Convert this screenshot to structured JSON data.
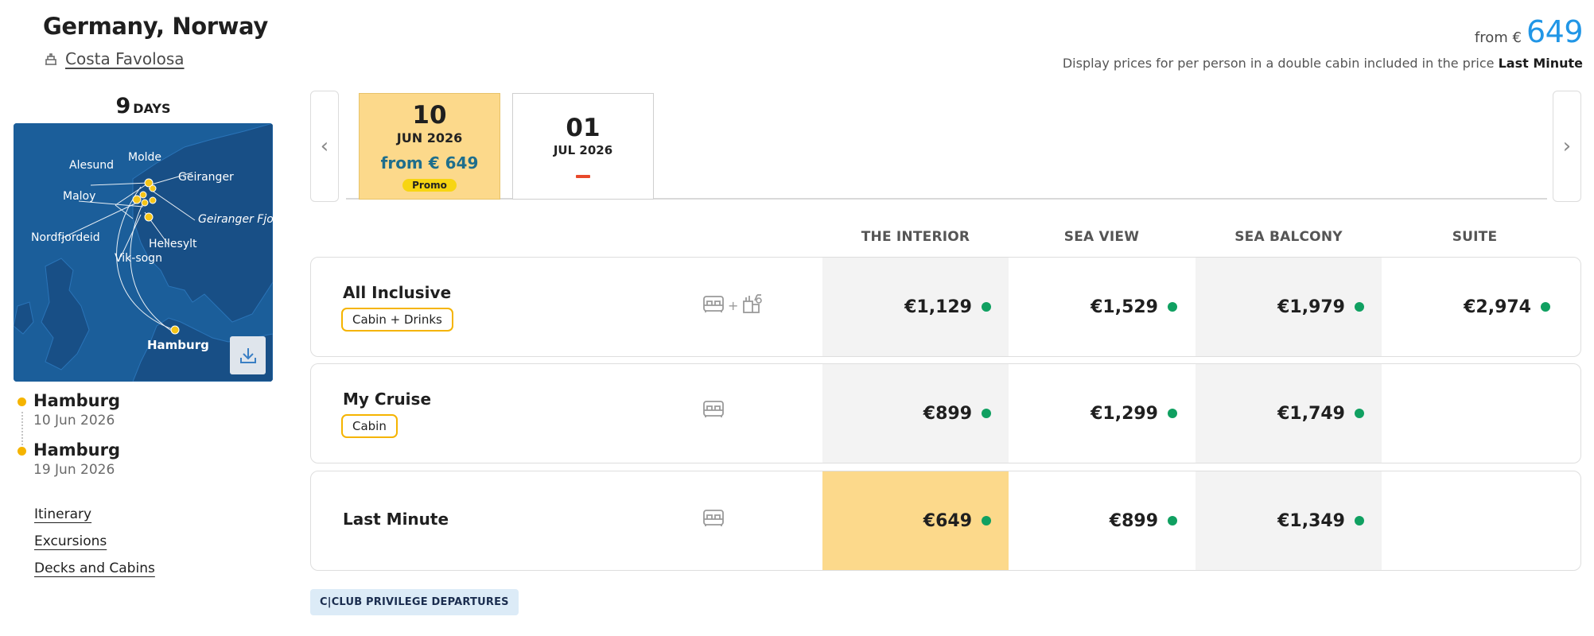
{
  "header": {
    "title": "Germany, Norway",
    "ship_name": "Costa Favolosa",
    "from_label": "from €",
    "from_amount": "649",
    "note_prefix": "Display prices for per person in a double cabin included in the price",
    "note_bold": "Last Minute"
  },
  "trip": {
    "days_number": "9",
    "days_unit": "DAYS"
  },
  "map": {
    "labels": {
      "molde": "Molde",
      "alesund": "Alesund",
      "geiranger": "Geiranger",
      "maloy": "Maloy",
      "geiranger_fjord": "Geiranger Fjord",
      "nordfjordeid": "Nordfjordeid",
      "hellesylt": "Hellesylt",
      "vik_sogn": "Vik-sogn",
      "hamburg": "Hamburg"
    }
  },
  "timeline": [
    {
      "city": "Hamburg",
      "date": "10 Jun 2026"
    },
    {
      "city": "Hamburg",
      "date": "19 Jun 2026"
    }
  ],
  "links": [
    "Itinerary",
    "Excursions",
    "Decks and Cabins"
  ],
  "dates": [
    {
      "day": "10",
      "month_year": "JUN 2026",
      "price": "from € 649",
      "badge": "Promo",
      "selected": true
    },
    {
      "day": "01",
      "month_year": "JUL 2026",
      "selected": false
    }
  ],
  "columns": [
    "THE INTERIOR",
    "SEA VIEW",
    "SEA BALCONY",
    "SUITE"
  ],
  "fares": [
    {
      "name": "All Inclusive",
      "tag": "Cabin + Drinks",
      "icons": [
        "bed-icon",
        "drinks-icon"
      ],
      "plus": "+",
      "prices": [
        "€1,129",
        "€1,529",
        "€1,979",
        "€2,974"
      ]
    },
    {
      "name": "My Cruise",
      "tag": "Cabin",
      "icons": [
        "bed-icon"
      ],
      "prices": [
        "€899",
        "€1,299",
        "€1,749",
        ""
      ]
    },
    {
      "name": "Last Minute",
      "icons": [
        "bed-icon"
      ],
      "prices": [
        "€649",
        "€899",
        "€1,349",
        ""
      ]
    }
  ],
  "club_badge": "C|CLUB PRIVILEGE DEPARTURES",
  "colors": {
    "accent_blue": "#2196e6",
    "highlight_yellow": "#fcd98b",
    "tag_border": "#f5b400",
    "availability_green": "#10a061",
    "map_sea": "#1b5e9a"
  }
}
